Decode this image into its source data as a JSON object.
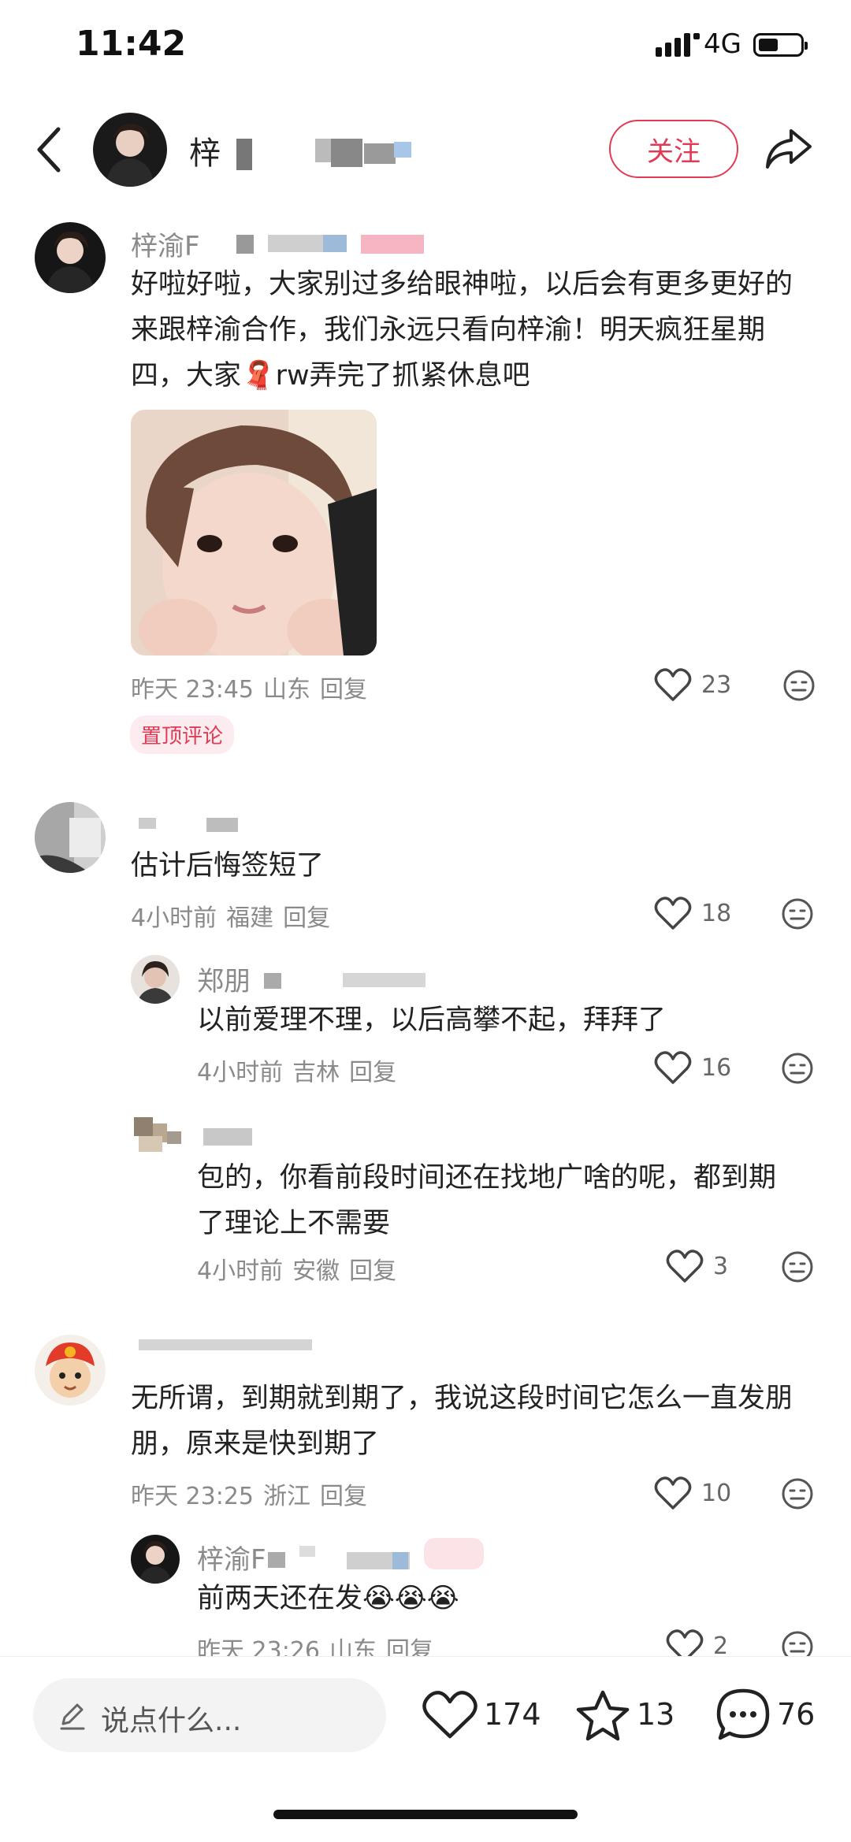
{
  "status_bar": {
    "time": "11:42",
    "network": "4G"
  },
  "header": {
    "title": "梓"
  },
  "follow_label": "关注",
  "comments": [
    {
      "user": "梓渝F",
      "text_lines": [
        "好啦好啦，大家别过多给眼神啦，以后会有更多更好的",
        "来跟梓渝合作，我们永远只看向梓渝！明天疯狂星期",
        "四，大家🧣rw弄完了抓紧休息吧"
      ],
      "time": "昨天 23:45",
      "location": "山东",
      "reply_label": "回复",
      "likes": "23",
      "pinned_label": "置顶评论"
    },
    {
      "user": "",
      "text_lines": [
        "估计后悔签短了"
      ],
      "time": "4小时前",
      "location": "福建",
      "reply_label": "回复",
      "likes": "18",
      "replies": [
        {
          "user": "郑朋",
          "text_lines": [
            "以前爱理不理，以后高攀不起，拜拜了"
          ],
          "time": "4小时前",
          "location": "吉林",
          "reply_label": "回复",
          "likes": "16"
        },
        {
          "user": "",
          "text_lines": [
            "包的，你看前段时间还在找地广啥的呢，都到期",
            "了理论上不需要"
          ],
          "time": "4小时前",
          "location": "安徽",
          "reply_label": "回复",
          "likes": "3"
        }
      ]
    },
    {
      "user": "",
      "text_lines": [
        "无所谓，到期就到期了，我说这段时间它怎么一直发朋",
        "朋，原来是快到期了"
      ],
      "time": "昨天 23:25",
      "location": "浙江",
      "reply_label": "回复",
      "likes": "10",
      "replies": [
        {
          "user": "梓渝F",
          "text_lines": [
            "前两天还在发😭😭😭"
          ],
          "time": "昨天 23:26",
          "location": "山东",
          "reply_label": "回复",
          "likes": "2"
        }
      ]
    }
  ],
  "bottom": {
    "placeholder": "说点什么...",
    "likes": "174",
    "favorites": "13",
    "comments": "76"
  },
  "colors": {
    "accent": "#e23a55"
  }
}
